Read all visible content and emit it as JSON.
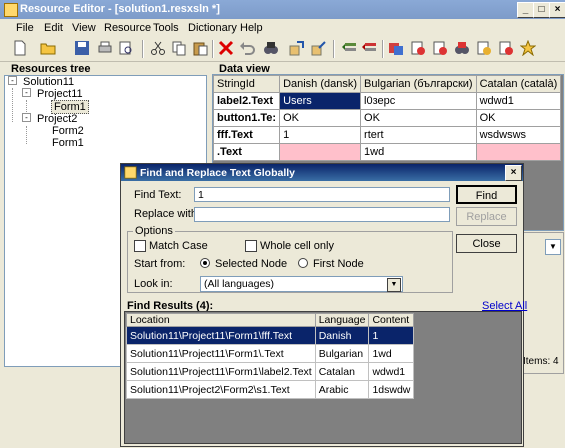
{
  "window": {
    "title": "Resource Editor - [solution1.resxsln *]"
  },
  "menu": [
    "File",
    "Edit",
    "View",
    "Resource",
    "Tools",
    "Dictionary",
    "Help"
  ],
  "toolbar_icons": [
    "new-file-icon",
    "open-folder-icon",
    "save-icon",
    "print-icon",
    "print-preview-icon",
    "cut-icon",
    "copy-icon",
    "paste-icon",
    "delete-icon",
    "undo-icon",
    "find-icon",
    "import-icon",
    "export-icon",
    "add-row-icon",
    "remove-row-icon",
    "translate-icon",
    "tool-a-icon",
    "tool-b-icon",
    "tool-c-icon",
    "tool-d-icon",
    "tool-e-icon",
    "star-icon"
  ],
  "tree": {
    "header": "Resources tree",
    "nodes": [
      "Solution11",
      "Project11",
      "Form1",
      "Project2",
      "Form2",
      "Form1"
    ]
  },
  "dataview": {
    "header": "Data view",
    "columns": [
      "StringId",
      "Danish (dansk)",
      "Bulgarian (български)",
      "Catalan (català)"
    ],
    "rows": [
      [
        "label2.Text",
        "Users",
        "l0зерс",
        "wdwd1"
      ],
      [
        "button1.Te:",
        "OK",
        "OK",
        "OK"
      ],
      [
        "fff.Text",
        "1",
        "rtert",
        "wsdwsws"
      ],
      [
        ".Text",
        "",
        "1wd",
        ""
      ]
    ]
  },
  "status": {
    "items": "Items: 4"
  },
  "dialog": {
    "title": "Find and Replace Text Globally",
    "find_label": "Find Text:",
    "find_value": "1",
    "replace_label": "Replace with:",
    "replace_value": "",
    "find_button": "Find",
    "replace_button": "Replace",
    "close_button": "Close",
    "options_label": "Options",
    "match_case": "Match Case",
    "whole_cell": "Whole cell only",
    "start_from_label": "Start from:",
    "selected_node": "Selected Node",
    "first_node": "First Node",
    "look_in_label": "Look in:",
    "look_in_value": "(All languages)",
    "results_label": "Find Results (4):",
    "select_all": "Select All",
    "results_columns": [
      "Location",
      "Language",
      "Content"
    ],
    "results": [
      [
        "Solution11\\Project11\\Form1\\fff.Text",
        "Danish",
        "1"
      ],
      [
        "Solution11\\Project11\\Form1\\.Text",
        "Bulgarian",
        "1wd"
      ],
      [
        "Solution11\\Project11\\Form1\\label2.Text",
        "Catalan",
        "wdwd1"
      ],
      [
        "Solution11\\Project2\\Form2\\s1.Text",
        "Arabic",
        "1dswdw"
      ]
    ]
  },
  "colors": {
    "selection": "#0a246a",
    "empty_cell": "#ffc0cb",
    "title_active": "#0a246a"
  }
}
